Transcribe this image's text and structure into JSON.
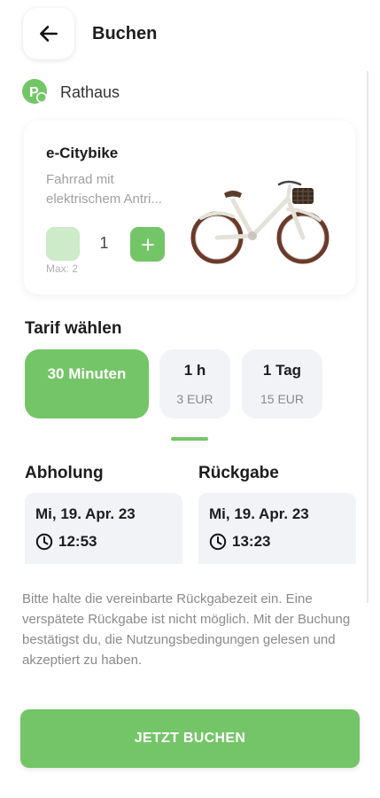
{
  "header": {
    "title": "Buchen",
    "back_icon": "arrow-left-icon"
  },
  "station": {
    "name": "Rathaus",
    "icon": "parking-station-icon",
    "accent": "#74c567"
  },
  "vehicle": {
    "name": "e-Citybike",
    "description": "Fahrrad mit elektrischem Antri...",
    "quantity": "1",
    "max_label": "Max: 2",
    "image": "city-bike-image"
  },
  "tariffs": {
    "title": "Tarif wählen",
    "options": [
      {
        "label": "30 Minuten",
        "price": "",
        "selected": true
      },
      {
        "label": "1 h",
        "price": "3 EUR",
        "selected": false
      },
      {
        "label": "1 Tag",
        "price": "15 EUR",
        "selected": false
      }
    ]
  },
  "pickup": {
    "title": "Abholung",
    "date": "Mi, 19. Apr. 23",
    "time": "12:53"
  },
  "return": {
    "title": "Rückgabe",
    "date": "Mi, 19. Apr. 23",
    "time": "13:23"
  },
  "notice": "Bitte halte die vereinbarte Rückgabezeit ein. Eine verspätete Rückgabe ist nicht möglich. Mit der Buchung bestätigst du, die Nutzungsbedingungen gelesen und akzeptiert zu haben.",
  "book_button": "JETZT BUCHEN",
  "colors": {
    "primary": "#74c567",
    "primary_light": "#cdeac9",
    "surface": "#f2f3f7"
  }
}
